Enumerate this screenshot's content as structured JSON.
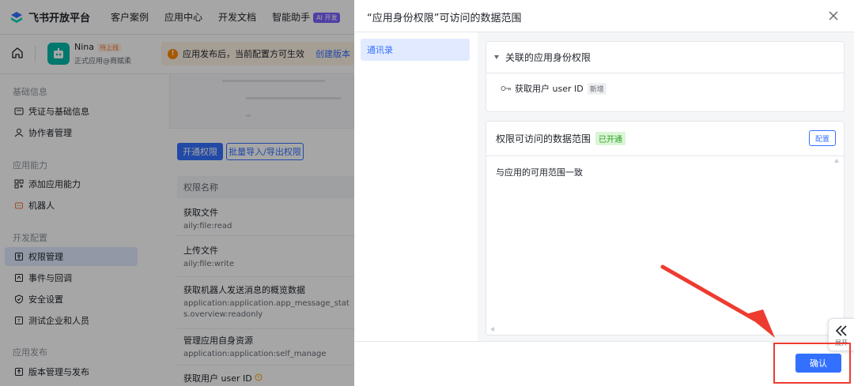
{
  "topbar": {
    "brand": "飞书开放平台",
    "nav": [
      "客户案例",
      "应用中心",
      "开发文档",
      "智能助手"
    ],
    "ai_badge": "AI 开发"
  },
  "app": {
    "name": "Nina",
    "status": "待上线",
    "subtitle": "正式应用@商赋柔",
    "notice": "应用发布后，当前配置方可生效",
    "notice_link": "创建版本"
  },
  "sidebar": {
    "section_basic": "基础信息",
    "item_credentials": "凭证与基础信息",
    "item_collaborators": "协作者管理",
    "section_capability": "应用能力",
    "item_add_capability": "添加应用能力",
    "item_bot": "机器人",
    "section_dev": "开发配置",
    "item_permissions": "权限管理",
    "item_events": "事件与回调",
    "item_security": "安全设置",
    "item_test": "测试企业和人员",
    "section_release": "应用发布",
    "item_version": "版本管理与发布"
  },
  "content": {
    "btn_enable": "开通权限",
    "btn_batch": "批量导入/导出权限",
    "table_header": "权限名称",
    "rows": [
      {
        "name": "获取文件",
        "code": "aily:file:read"
      },
      {
        "name": "上传文件",
        "code": "aily:file:write"
      },
      {
        "name": "获取机器人发送消息的概览数据",
        "code": "application:application.app_message_stats.overview:readonly"
      },
      {
        "name": "管理应用自身资源",
        "code": "application:application:self_manage"
      },
      {
        "name": "获取用户 user ID",
        "code": ""
      }
    ]
  },
  "modal": {
    "title": "“应用身份权限”可访问的数据范围",
    "nav_item": "通讯录",
    "related_header": "关联的应用身份权限",
    "perm_name": "获取用户 user ID",
    "perm_tag": "新增",
    "scope_header": "权限可访问的数据范围",
    "scope_status": "已开通",
    "config_button": "配置",
    "scope_value": "与应用的可用范围一致",
    "confirm_button": "确认",
    "expand_label": "展开"
  },
  "colors": {
    "accent": "#3370ff",
    "highlight_box": "#ee3b2f",
    "success": "#2ea121"
  }
}
